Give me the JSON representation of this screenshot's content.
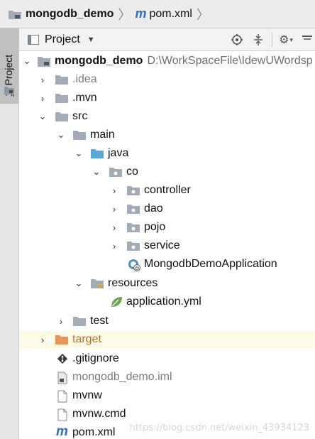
{
  "breadcrumb": {
    "project": "mongodb_demo",
    "file": "pom.xml",
    "file_icon": "m"
  },
  "sidebar": {
    "tab_number": "1",
    "tab_label": ": Project"
  },
  "panel": {
    "title": "Project",
    "tools": [
      "locate-icon",
      "collapse-icon",
      "gear-icon",
      "hide-icon"
    ]
  },
  "tree": {
    "root": {
      "name": "mongodb_demo",
      "path": "D:\\WorkSpaceFile\\IdewUWordsp"
    },
    "idea": ".idea",
    "mvn": ".mvn",
    "src": "src",
    "main": "main",
    "java": "java",
    "co": "co",
    "controller": "controller",
    "dao": "dao",
    "pojo": "pojo",
    "service": "service",
    "app_class": "MongodbDemoApplication",
    "resources": "resources",
    "app_yml": "application.yml",
    "test": "test",
    "target": "target",
    "gitignore": ".gitignore",
    "iml": "mongodb_demo.iml",
    "mvnw": "mvnw",
    "mvnw_cmd": "mvnw.cmd",
    "pom": "pom.xml"
  },
  "watermark": "https://blog.csdn.net/weixin_43934123",
  "colors": {
    "folder": "#a3acb6",
    "source_folder": "#5aa7d8",
    "excluded_folder": "#e8945a",
    "spring_green": "#6aa84f",
    "maven_blue": "#2f6ec4"
  }
}
